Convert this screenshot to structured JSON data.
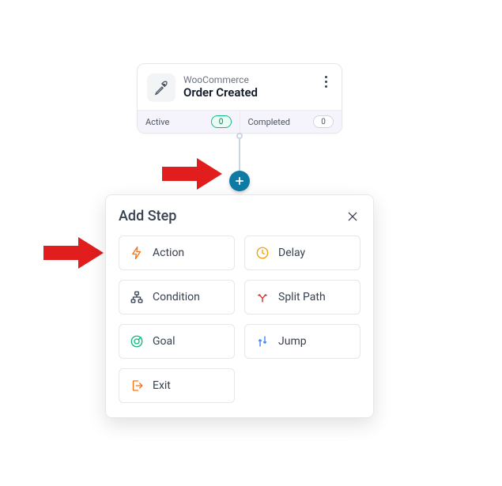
{
  "trigger": {
    "source": "WooCommerce",
    "title": "Order Created",
    "active_label": "Active",
    "active_count": "0",
    "completed_label": "Completed",
    "completed_count": "0"
  },
  "panel": {
    "title": "Add Step",
    "options": {
      "action": "Action",
      "delay": "Delay",
      "condition": "Condition",
      "split": "Split Path",
      "goal": "Goal",
      "jump": "Jump",
      "exit": "Exit"
    }
  }
}
